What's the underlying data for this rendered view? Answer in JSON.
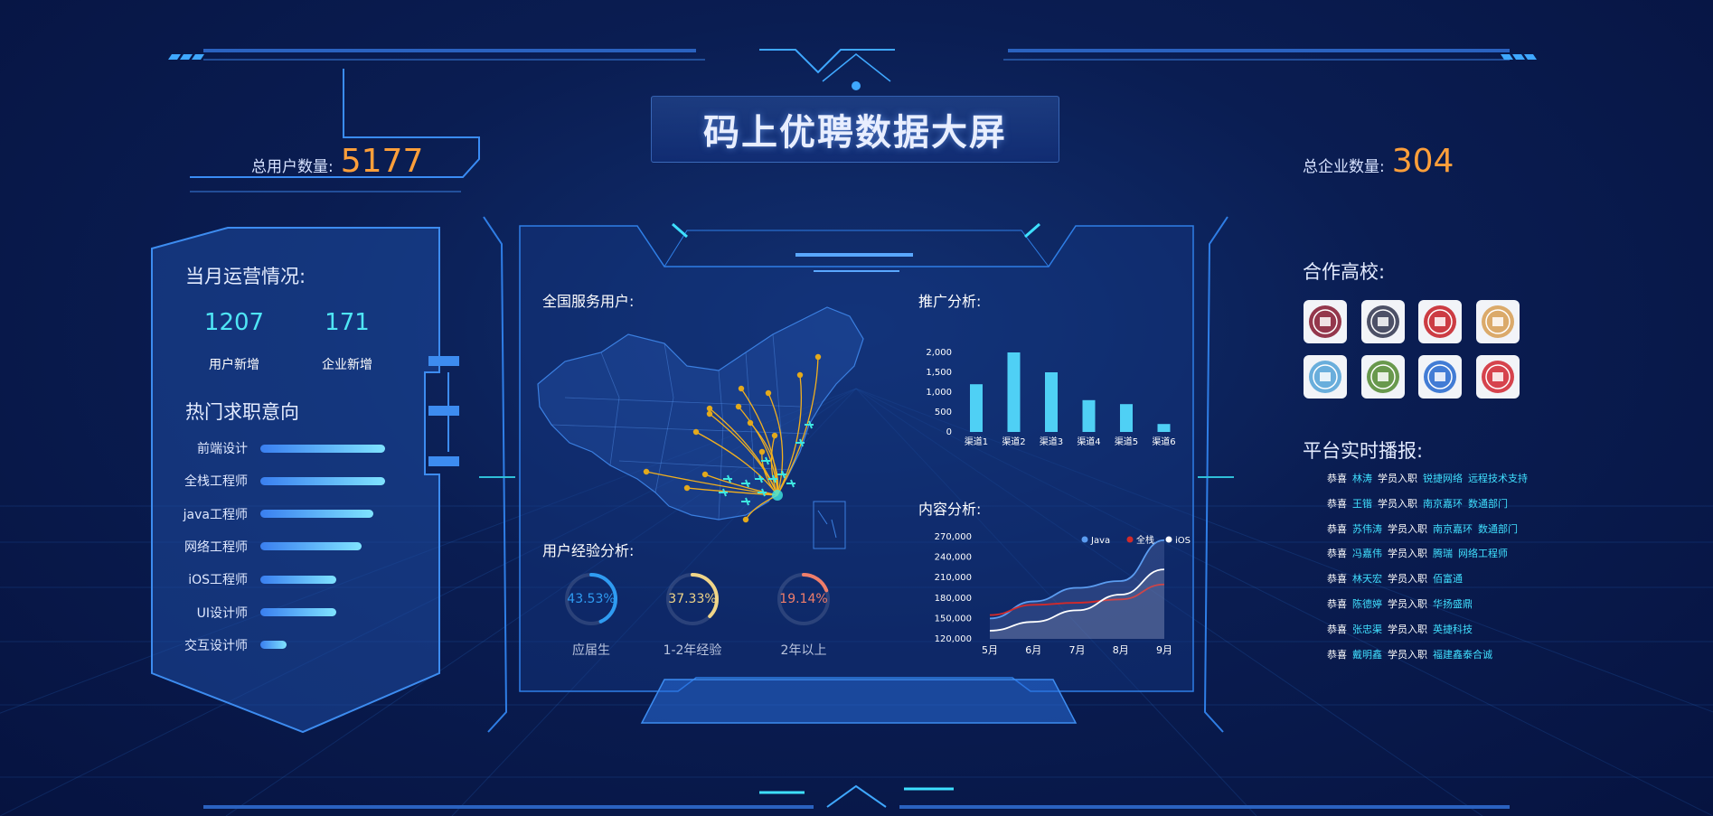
{
  "page": {
    "title": "码上优聘数据大屏"
  },
  "stats": {
    "total_users": {
      "label": "总用户数量:",
      "value": "5177"
    },
    "total_companies": {
      "label": "总企业数量:",
      "value": "304"
    }
  },
  "monthly": {
    "title": "当月运营情况:",
    "new_users": {
      "value": "1207",
      "label": "用户新增"
    },
    "new_companies": {
      "value": "171",
      "label": "企业新增"
    }
  },
  "hot_jobs": {
    "title": "热门求职意向",
    "items": [
      {
        "label": "前端设计",
        "value": 0.95
      },
      {
        "label": "全栈工程师",
        "value": 0.95
      },
      {
        "label": "java工程师",
        "value": 0.86
      },
      {
        "label": "网络工程师",
        "value": 0.77
      },
      {
        "label": "iOS工程师",
        "value": 0.58
      },
      {
        "label": "UI设计师",
        "value": 0.58
      },
      {
        "label": "交互设计师",
        "value": 0.2
      }
    ]
  },
  "map_section": {
    "title": "全国服务用户:"
  },
  "experience": {
    "title": "用户经验分析:",
    "rings": [
      {
        "value": "43.53%",
        "label": "应届生",
        "fraction": 0.4353,
        "color": "#2f9cf2"
      },
      {
        "value": "37.33%",
        "label": "1-2年经验",
        "fraction": 0.3733,
        "color": "#f0d588"
      },
      {
        "value": "19.14%",
        "label": "2年以上",
        "fraction": 0.1914,
        "color": "#f07e6a"
      }
    ]
  },
  "promotion": {
    "title": "推广分析:"
  },
  "content": {
    "title": "内容分析:"
  },
  "chart_data": [
    {
      "type": "bar",
      "categories": [
        "渠道1",
        "渠道2",
        "渠道3",
        "渠道4",
        "渠道5",
        "渠道6"
      ],
      "values": [
        1200,
        2000,
        1500,
        800,
        700,
        200
      ],
      "yticks": [
        "2,000",
        "1,500",
        "1,000",
        "500",
        "0"
      ],
      "ylim": [
        0,
        2000
      ],
      "color": "#4fd0f5"
    },
    {
      "type": "line",
      "x": [
        "5月",
        "6月",
        "7月",
        "8月",
        "9月"
      ],
      "yticks": [
        "270,000",
        "240,000",
        "210,000",
        "180,000",
        "150,000",
        "120,000"
      ],
      "ylim": [
        120000,
        270000
      ],
      "legend_position": "top-right",
      "series": [
        {
          "name": "Java",
          "color": "#5b9cf0",
          "values": [
            150000,
            175000,
            195000,
            205000,
            265000
          ]
        },
        {
          "name": "全栈",
          "color": "#d22a2a",
          "values": [
            155000,
            170000,
            173000,
            178000,
            200000
          ]
        },
        {
          "name": "iOS",
          "color": "#ffffff",
          "values": [
            132000,
            145000,
            162000,
            185000,
            222000
          ]
        }
      ]
    }
  ],
  "universities": {
    "title": "合作高校:",
    "logos": [
      {
        "icon": "university-seal-icon",
        "color": "#8a2238"
      },
      {
        "icon": "university-gate-icon",
        "color": "#3b3f56"
      },
      {
        "icon": "university-seal-icon",
        "color": "#c8282f"
      },
      {
        "icon": "university-seal-icon",
        "color": "#d8a25a"
      },
      {
        "icon": "university-seal-icon",
        "color": "#5aa6d8"
      },
      {
        "icon": "university-seal-icon",
        "color": "#5a8f3a"
      },
      {
        "icon": "university-cap-icon",
        "color": "#2f6fd0"
      },
      {
        "icon": "university-seal-icon",
        "color": "#d3303a"
      }
    ]
  },
  "news": {
    "title": "平台实时播报:",
    "items": [
      {
        "congrats": "恭喜",
        "name": "林涛",
        "action": "学员入职",
        "company": "锐捷网络",
        "position": "远程技术支持"
      },
      {
        "congrats": "恭喜",
        "name": "王锴",
        "action": "学员入职",
        "company": "南京嘉环",
        "position": "数通部门"
      },
      {
        "congrats": "恭喜",
        "name": "苏伟涛",
        "action": "学员入职",
        "company": "南京嘉环",
        "position": "数通部门"
      },
      {
        "congrats": "恭喜",
        "name": "冯嘉伟",
        "action": "学员入职",
        "company": "腾瑞",
        "position": "网络工程师"
      },
      {
        "congrats": "恭喜",
        "name": "林天宏",
        "action": "学员入职",
        "company": "佰富通",
        "position": ""
      },
      {
        "congrats": "恭喜",
        "name": "陈德婷",
        "action": "学员入职",
        "company": "华扬盛鼎",
        "position": ""
      },
      {
        "congrats": "恭喜",
        "name": "张忠渠",
        "action": "学员入职",
        "company": "英捷科技",
        "position": ""
      },
      {
        "congrats": "恭喜",
        "name": "戴明鑫",
        "action": "学员入职",
        "company": "福建鑫泰合诚",
        "position": ""
      }
    ]
  }
}
